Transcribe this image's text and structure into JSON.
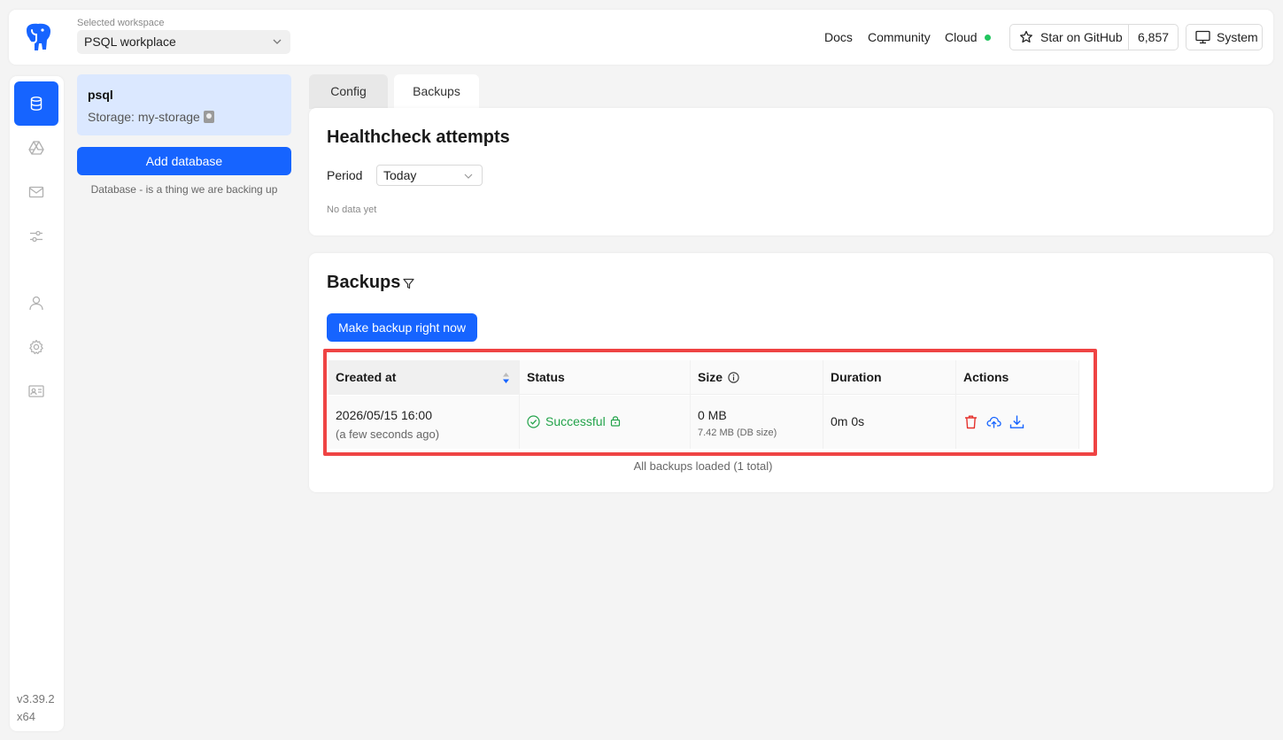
{
  "header": {
    "workspace_label": "Selected workspace",
    "workspace_value": "PSQL workplace",
    "nav": [
      "Docs",
      "Community",
      "Cloud"
    ],
    "github_label": "Star on GitHub",
    "github_count": "6,857",
    "system_label": "System"
  },
  "sidebar": {
    "items": [
      {
        "name": "databases",
        "icon": "database-icon",
        "active": true
      },
      {
        "name": "storages",
        "icon": "drive-icon",
        "active": false
      },
      {
        "name": "notifiers",
        "icon": "mail-icon",
        "active": false
      },
      {
        "name": "settings-sliders",
        "icon": "sliders-icon",
        "active": false
      },
      {
        "name": "users",
        "icon": "user-icon",
        "active": false
      },
      {
        "name": "settings",
        "icon": "gear-icon",
        "active": false
      },
      {
        "name": "profile",
        "icon": "id-card-icon",
        "active": false
      }
    ],
    "version": "v3.39.2",
    "arch": "x64"
  },
  "databases": {
    "items": [
      {
        "name": "psql",
        "storage": "Storage: my-storage"
      }
    ],
    "add_button": "Add database",
    "hint": "Database - is a thing we are backing up"
  },
  "tabs": [
    "Config",
    "Backups"
  ],
  "active_tab": "Backups",
  "healthcheck": {
    "title": "Healthcheck attempts",
    "period_label": "Period",
    "period_value": "Today",
    "empty": "No data yet"
  },
  "backups": {
    "title": "Backups",
    "make_button": "Make backup right now",
    "columns": [
      "Created at",
      "Status",
      "Size",
      "Duration",
      "Actions"
    ],
    "rows": [
      {
        "created": "2026/05/15 16:00",
        "created_relative": "(a few seconds ago)",
        "status": "Successful",
        "size": "0 MB",
        "db_size": "7.42 MB (DB size)",
        "duration": "0m 0s"
      }
    ],
    "footer": "All backups loaded (1 total)"
  },
  "colors": {
    "primary": "#1664ff",
    "success": "#23a34a",
    "danger": "#e5322d",
    "highlight": "#ef4444"
  }
}
